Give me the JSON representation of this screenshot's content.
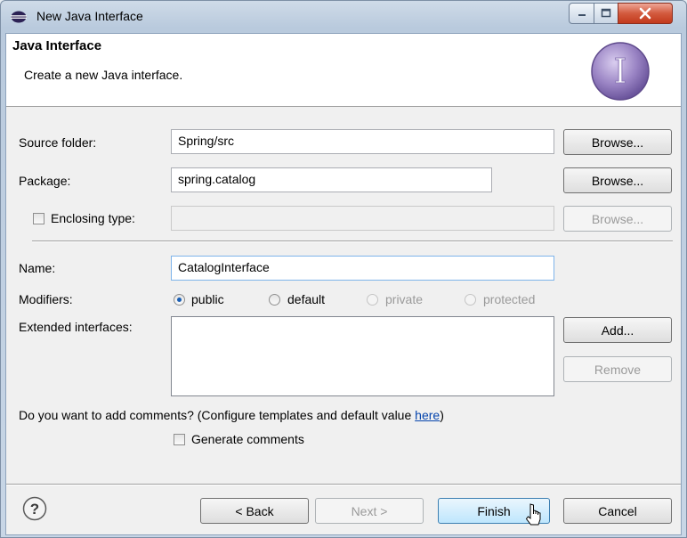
{
  "window": {
    "title": "New Java Interface"
  },
  "header": {
    "title": "Java Interface",
    "description": "Create a new Java interface."
  },
  "fields": {
    "source_folder_label": "Source folder:",
    "source_folder_value": "Spring/src",
    "package_label": "Package:",
    "package_value": "spring.catalog",
    "enclosing_type_label": "Enclosing type:",
    "enclosing_type_value": "",
    "name_label": "Name:",
    "name_value": "CatalogInterface",
    "modifiers_label": "Modifiers:",
    "extended_interfaces_label": "Extended interfaces:"
  },
  "modifiers": [
    {
      "label": "public",
      "selected": true,
      "enabled": true
    },
    {
      "label": "default",
      "selected": false,
      "enabled": true
    },
    {
      "label": "private",
      "selected": false,
      "enabled": false
    },
    {
      "label": "protected",
      "selected": false,
      "enabled": false
    }
  ],
  "buttons": {
    "browse": "Browse...",
    "add": "Add...",
    "remove": "Remove",
    "back": "< Back",
    "next": "Next >",
    "finish": "Finish",
    "cancel": "Cancel"
  },
  "comments": {
    "question": "Do you want to add comments? (Configure templates and default value ",
    "link": "here",
    "close_paren": ")",
    "generate_label": "Generate comments"
  },
  "icons": {
    "app": "eclipse-icon",
    "header": "java-interface-icon",
    "help": "help-icon",
    "cursor": "mouse-pointer-icon"
  },
  "colors": {
    "accent": "#9a84c4",
    "link": "#0645ad",
    "close": "#c2391c"
  }
}
